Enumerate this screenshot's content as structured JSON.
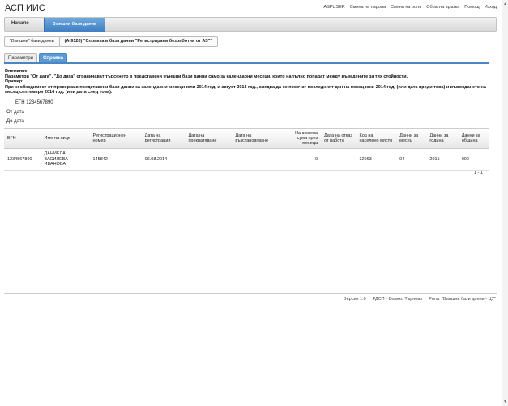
{
  "app": {
    "title": "АСП ИИС"
  },
  "toplinks": [
    "ASPUSER",
    "Смяна на парола",
    "Смяна на роля",
    "Обратна връзка",
    "Помощ",
    "Изход"
  ],
  "nav": {
    "home": "Начало",
    "active": "Външни бази данни"
  },
  "breadcrumb": {
    "first": "\"Външни\" бази данни",
    "second": "(А-9120) \"Справка в база данни \"Регистрирани безработни от АЗ\"\""
  },
  "tabs": {
    "params": "Параметри",
    "report": "Справка"
  },
  "notes": {
    "attention_label": "Внимание:",
    "attention_text": "Параметри \"От дата\", \"До дата\" ограничават търсенето в представени външни бази данни само за календарни месеци, които напълно попадат между въведените за тях стойности.",
    "example_label": "Пример:",
    "example_text": "При необходимост от проверка в представени бази данни за календарни месеци юли 2014 год. и август 2014 год., следва да се посочат последният ден на месец юни 2014 год. (или дата преди това) и въвеждането на месец септември 2014 год. (или дата след това)."
  },
  "filters": {
    "egn": "ЕГН 1234567890",
    "from": "От дата",
    "to": "До дата"
  },
  "table": {
    "headers": [
      "ЕГН",
      "Име на лице",
      "Регистрационен номер",
      "Дата на регистрация",
      "Дата на прекратяване",
      "Дата на възстановяване",
      "Начислена сума през месеца",
      "Дата на отказ от работа",
      "Код на населено място",
      "Данни за месец",
      "Данни за година",
      "Данни за община"
    ],
    "row": [
      "1234567890",
      "ДАНИЕЛА ВАСИЛЕВА ИВАНОВА",
      "145842",
      "06.08.2014",
      "-",
      "-",
      "0",
      "-",
      "32963",
      "04",
      "2015",
      "000"
    ]
  },
  "pager": "1 - 1",
  "footer": [
    "Версия 1.0",
    "РДСП - Велико Търново",
    "Роля: \"Външни бази данни - ЦУ\""
  ]
}
